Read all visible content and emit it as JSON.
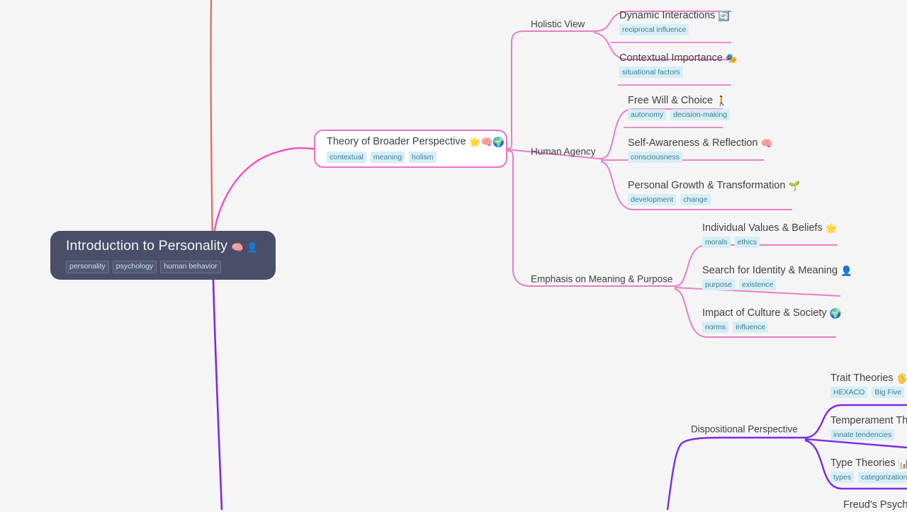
{
  "colors": {
    "background": "#f5f5f5",
    "root_fill": "#4a4e69",
    "branch_pink": "#ee6fd0",
    "branch_pink_soft": "#e87ec4",
    "branch_salmon": "#e06c5f",
    "branch_purple": "#7d2ae8",
    "tag_fill": "#d6eef5",
    "tag_text": "#3f7f93",
    "text": "#3f3f46"
  },
  "root": {
    "title": "Introduction to Personality",
    "emojis": "🧠 👤",
    "tags": [
      "personality",
      "psychology",
      "human behavior"
    ]
  },
  "branch": {
    "title": "Theory of Broader Perspective",
    "emojis": "🌟🧠🌍",
    "tags": [
      "contextual",
      "meaning",
      "holism"
    ]
  },
  "groups": [
    {
      "label": "Holistic View",
      "leaves": [
        {
          "title": "Dynamic Interactions",
          "emojis": "🔄",
          "tags": [
            "reciprocal influence"
          ]
        },
        {
          "title": "Contextual Importance",
          "emojis": "🎭",
          "tags": [
            "situational factors"
          ]
        }
      ]
    },
    {
      "label": "Human Agency",
      "leaves": [
        {
          "title": "Free Will & Choice",
          "emojis": "🚶",
          "tags": [
            "autonomy",
            "decision-making"
          ]
        },
        {
          "title": "Self-Awareness & Reflection",
          "emojis": "🧠",
          "tags": [
            "consciousness"
          ]
        },
        {
          "title": "Personal Growth & Transformation",
          "emojis": "🌱",
          "tags": [
            "development",
            "change"
          ]
        }
      ]
    },
    {
      "label": "Emphasis on Meaning & Purpose",
      "leaves": [
        {
          "title": "Individual Values & Beliefs",
          "emojis": "🌟",
          "tags": [
            "morals",
            "ethics"
          ]
        },
        {
          "title": "Search for Identity & Meaning",
          "emojis": "👤",
          "tags": [
            "purpose",
            "existence"
          ]
        },
        {
          "title": "Impact of Culture & Society",
          "emojis": "🌍",
          "tags": [
            "norms",
            "influence"
          ]
        }
      ]
    },
    {
      "label": "Dispositional Perspective",
      "leaves": [
        {
          "title": "Trait Theories",
          "emojis": "🖐️🌐",
          "tags": [
            "HEXACO",
            "Big Five"
          ]
        },
        {
          "title": "Temperament The",
          "emojis": "",
          "tags": [
            "innate tendencies"
          ]
        },
        {
          "title": "Type Theories",
          "emojis": "📊",
          "tags": [
            "types",
            "categorization"
          ]
        }
      ]
    }
  ],
  "clipped": {
    "freud_fragment": "Freud's Psycho"
  }
}
